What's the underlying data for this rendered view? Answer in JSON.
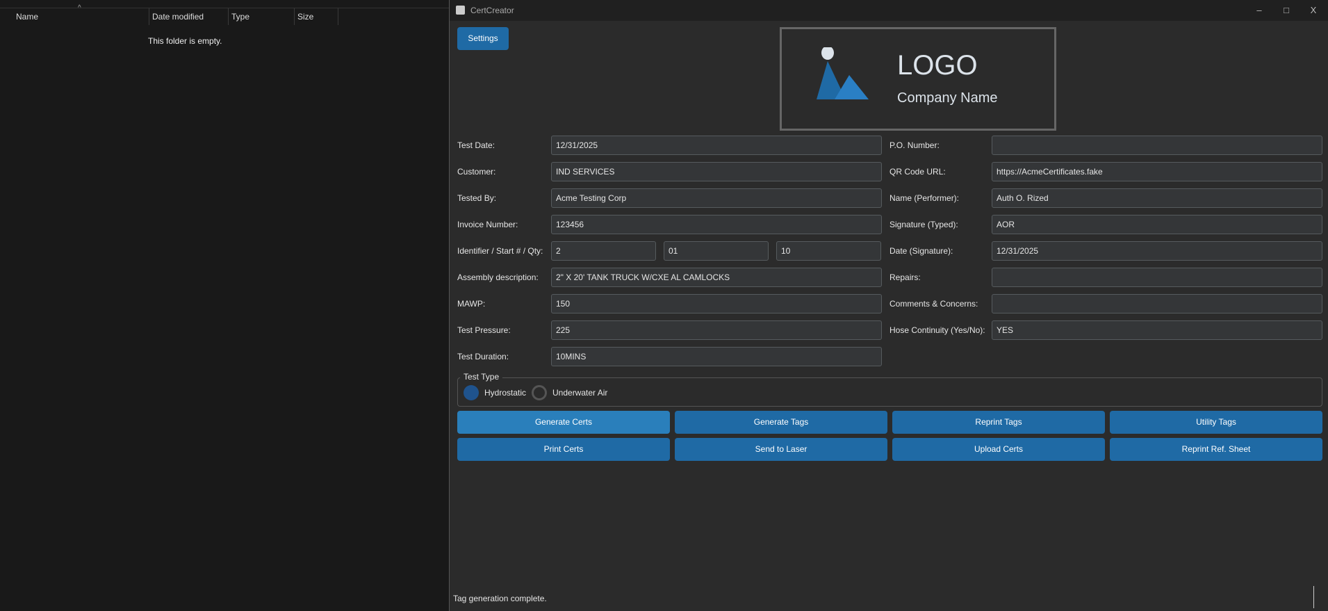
{
  "explorer": {
    "columns": [
      "Name",
      "Date modified",
      "Type",
      "Size"
    ],
    "empty_text": "This folder is empty."
  },
  "window": {
    "title": "CertCreator",
    "settings_label": "Settings"
  },
  "logo": {
    "title": "LOGO",
    "company": "Company Name"
  },
  "form_left": [
    {
      "label": "Test Date:",
      "value": "12/31/2025"
    },
    {
      "label": "Customer:",
      "value": "IND SERVICES"
    },
    {
      "label": "Tested By:",
      "value": "Acme Testing Corp"
    },
    {
      "label": "Invoice Number:",
      "value": "123456"
    },
    {
      "label": "Identifier / Start # / Qty:",
      "values": [
        "2",
        "01",
        "10"
      ]
    },
    {
      "label": "Assembly description:",
      "value": "2\" X 20' TANK TRUCK W/CXE AL CAMLOCKS"
    },
    {
      "label": "MAWP:",
      "value": "150"
    },
    {
      "label": "Test Pressure:",
      "value": "225"
    },
    {
      "label": "Test Duration:",
      "value": "10MINS"
    }
  ],
  "form_right": [
    {
      "label": "P.O. Number:",
      "value": ""
    },
    {
      "label": "QR Code URL:",
      "value": "https://AcmeCertificates.fake"
    },
    {
      "label": "Name (Performer):",
      "value": "Auth O. Rized"
    },
    {
      "label": "Signature (Typed):",
      "value": "AOR"
    },
    {
      "label": "Date (Signature):",
      "value": "12/31/2025"
    },
    {
      "label": "Repairs:",
      "value": ""
    },
    {
      "label": "Comments & Concerns:",
      "value": ""
    },
    {
      "label": "Hose Continuity (Yes/No):",
      "value": "YES"
    }
  ],
  "test_type": {
    "legend": "Test Type",
    "options": [
      "Hydrostatic",
      "Underwater Air"
    ],
    "selected": "Hydrostatic"
  },
  "actions": [
    "Generate Certs",
    "Generate Tags",
    "Reprint Tags",
    "Utility Tags",
    "Print Certs",
    "Send to Laser",
    "Upload Certs",
    "Reprint Ref. Sheet"
  ],
  "status": "Tag generation complete.",
  "colors": {
    "accent": "#1f6aa5",
    "hover": "#2a7fbb",
    "bg": "#2b2b2b"
  }
}
